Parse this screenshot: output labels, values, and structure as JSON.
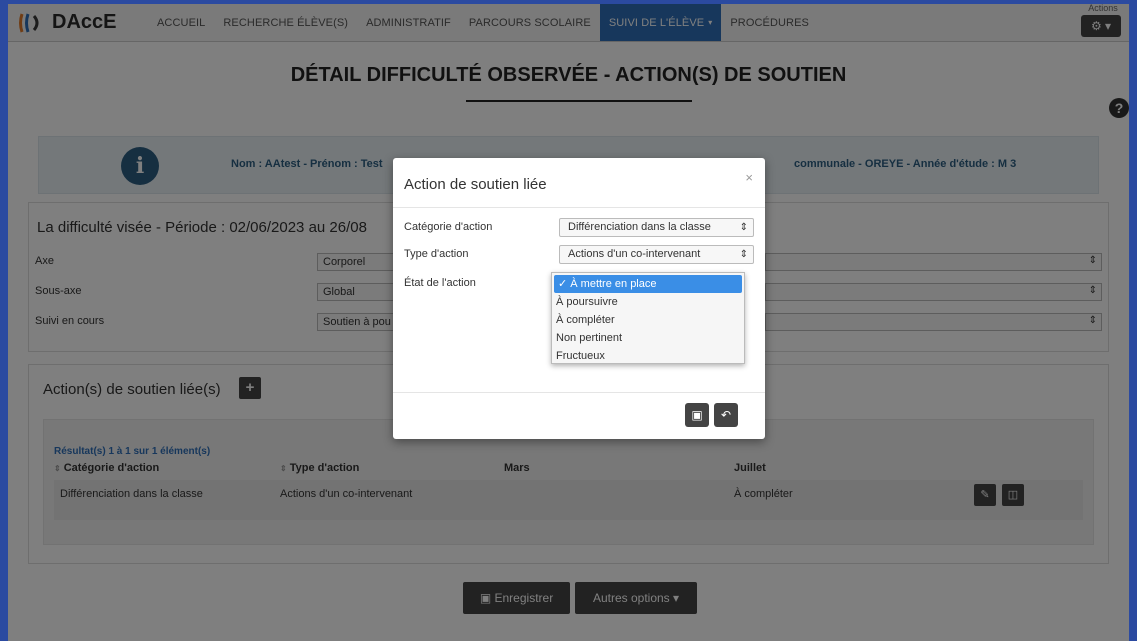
{
  "navbar": {
    "brand": "DAccE",
    "items": [
      "ACCUEIL",
      "RECHERCHE ÉLÈVE(S)",
      "ADMINISTRATIF",
      "PARCOURS SCOLAIRE",
      "SUIVI DE L'ÉLÈVE",
      "PROCÉDURES"
    ],
    "active_caret": "▾",
    "actions_label": "Actions"
  },
  "page": {
    "title": "DÉTAIL DIFFICULTÉ OBSERVÉE - ACTION(S) DE SOUTIEN",
    "info_left": "Nom : AAtest - Prénom : Test",
    "info_right": "communale - OREYE - Année d'étude : M 3"
  },
  "difficulty": {
    "title": "La difficulté visée - Période : 02/06/2023 au 26/08",
    "rows": [
      {
        "label": "Axe",
        "value": "Corporel"
      },
      {
        "label": "Sous-axe",
        "value": "Global"
      },
      {
        "label": "Suivi en cours",
        "value": "Soutien à pou"
      }
    ]
  },
  "actions_panel": {
    "title": "Action(s) de soutien liée(s)",
    "add_label": "+",
    "result_count": "Résultat(s) 1 à 1 sur 1 élément(s)",
    "columns": [
      "Catégorie d'action",
      "Type d'action",
      "Mars",
      "Juillet"
    ],
    "rows": [
      {
        "categorie": "Différenciation dans la classe",
        "type": "Actions d'un co-intervenant",
        "mars": "",
        "juillet": "À compléter"
      }
    ]
  },
  "bottom": {
    "save_label": "Enregistrer",
    "other_label": "Autres options"
  },
  "modal": {
    "title": "Action de soutien liée",
    "close": "×",
    "fields": [
      {
        "label": "Catégorie d'action",
        "value": "Différenciation dans la classe"
      },
      {
        "label": "Type d'action",
        "value": "Actions d'un co-intervenant"
      },
      {
        "label": "État de l'action",
        "value": "À mettre en place"
      }
    ],
    "state_options": [
      "✓ À mettre en place",
      "À poursuivre",
      "À compléter",
      "Non pertinent",
      "Fructueux"
    ]
  },
  "icons": {
    "info": "i",
    "help": "?",
    "wrench": "🔧",
    "pencil": "✎",
    "trash": "🗑",
    "save": "🖫",
    "undo": "↶",
    "updown": "⇕"
  },
  "colors": {
    "active_nav": "#2f6fb8",
    "info_icon": "#2d5f82",
    "dropdown_selected": "#3a8ee6"
  }
}
